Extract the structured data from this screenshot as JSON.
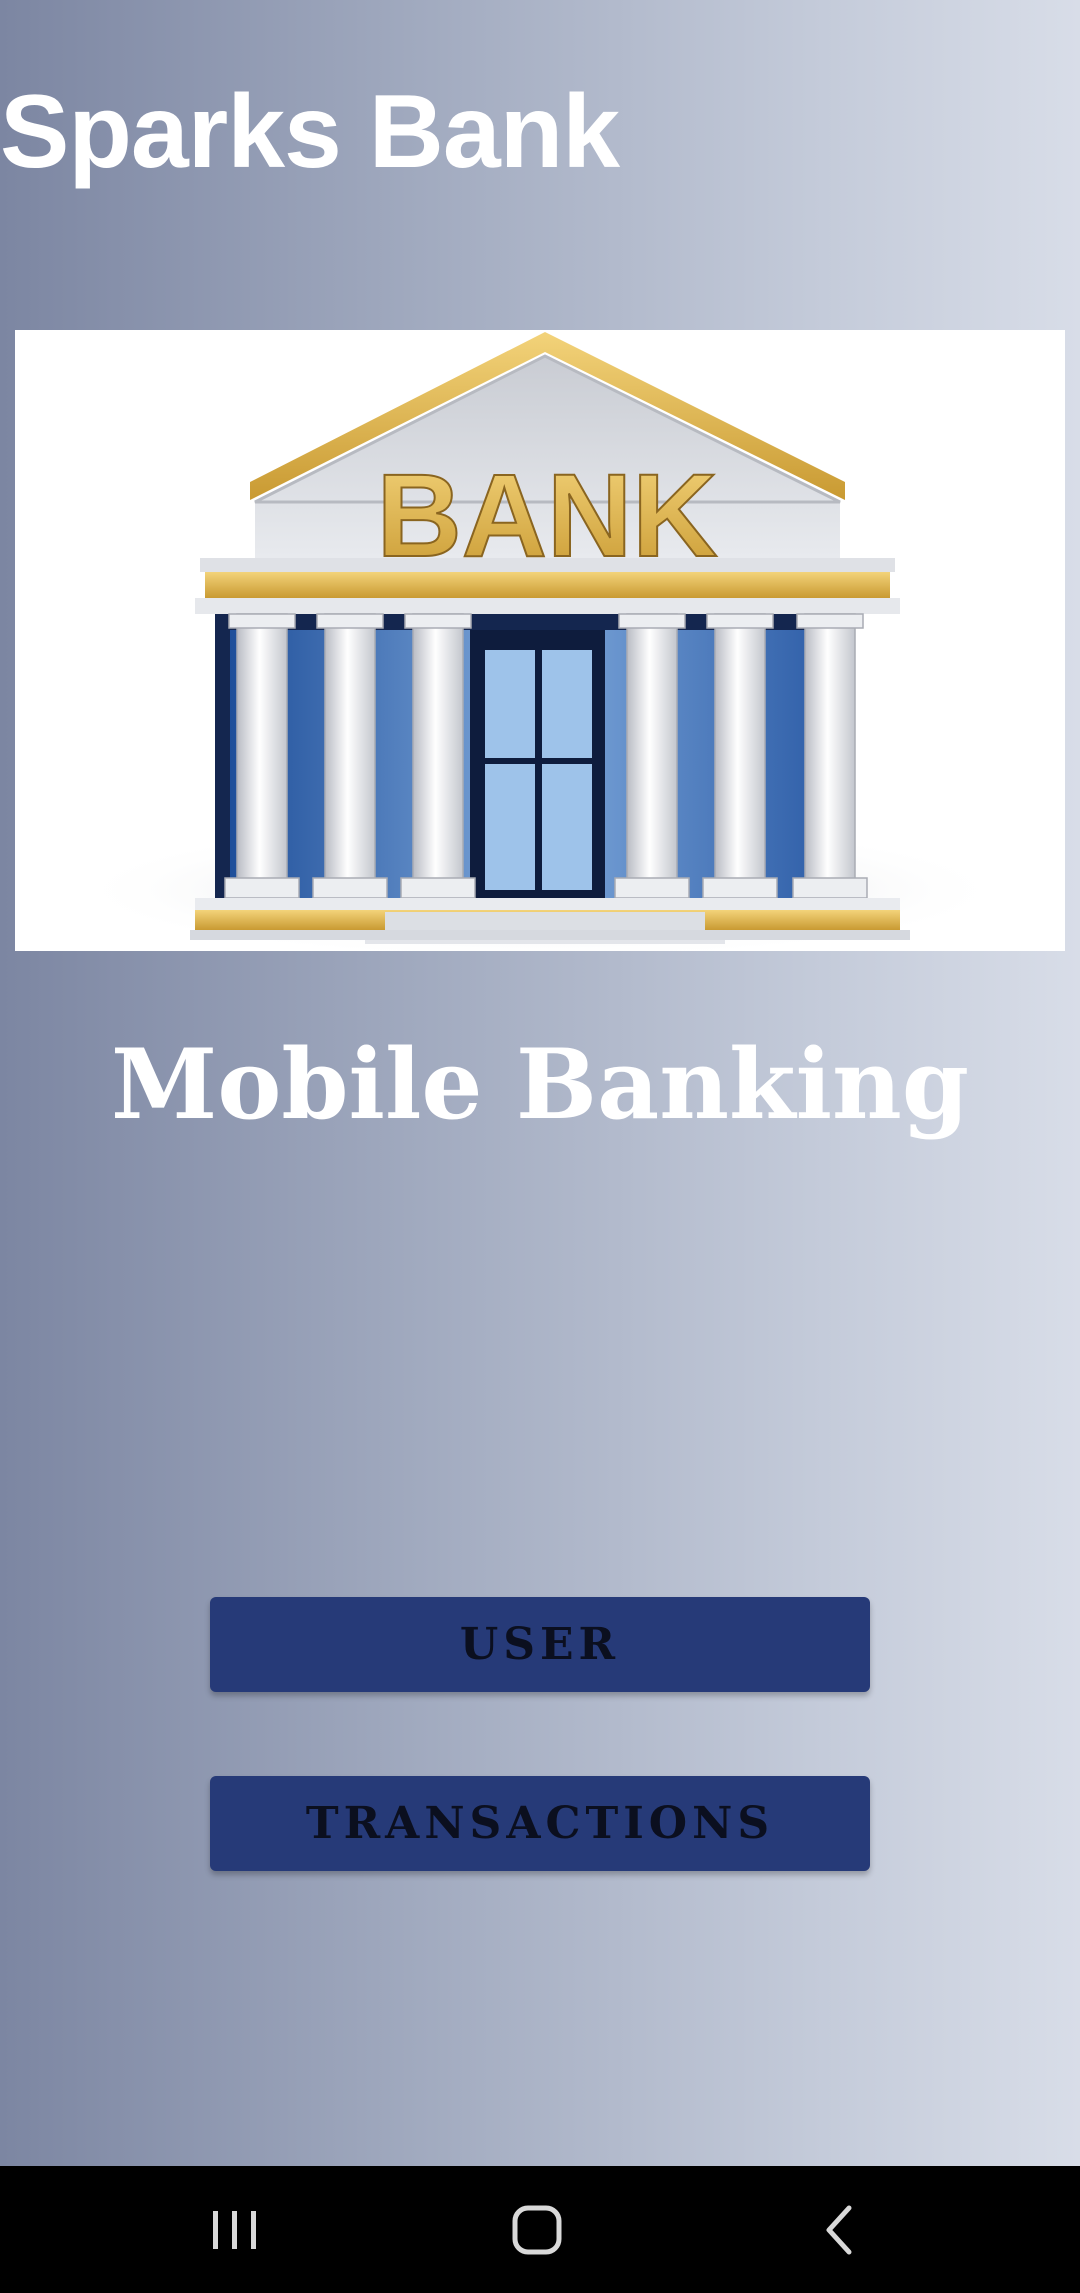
{
  "app": {
    "title": "Sparks Bank"
  },
  "hero": {
    "sign_text": "BANK"
  },
  "main": {
    "subtitle": "Mobile Banking",
    "buttons": {
      "user_label": "USER",
      "transactions_label": "TRANSACTIONS"
    }
  },
  "navbar": {
    "icons": [
      "recent-apps-icon",
      "home-icon",
      "back-icon"
    ]
  },
  "colors": {
    "button_bg": "#263a78",
    "bank_gold": "#e3b64a",
    "nav_bg": "#000000"
  }
}
